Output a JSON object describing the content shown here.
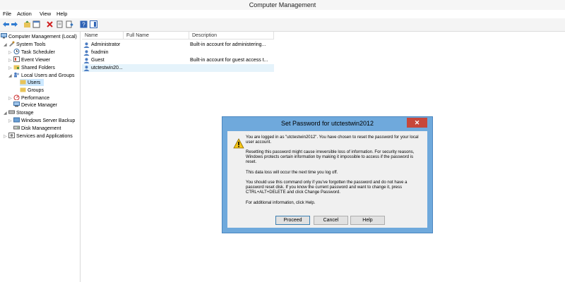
{
  "window": {
    "title": "Computer Management"
  },
  "menu": [
    "File",
    "Action",
    "View",
    "Help"
  ],
  "tree": {
    "root": "Computer Management (Local)",
    "system_tools": "System Tools",
    "task_scheduler": "Task Scheduler",
    "event_viewer": "Event Viewer",
    "shared_folders": "Shared Folders",
    "local_users_groups": "Local Users and Groups",
    "users": "Users",
    "groups": "Groups",
    "performance": "Performance",
    "device_manager": "Device Manager",
    "storage": "Storage",
    "windows_server_backup": "Windows Server Backup",
    "disk_management": "Disk Management",
    "services_applications": "Services and Applications"
  },
  "list": {
    "columns": [
      "Name",
      "Full Name",
      "Description"
    ],
    "rows": [
      {
        "name": "Administrator",
        "full_name": "",
        "description": "Built-in account for administering..."
      },
      {
        "name": "fxadmin",
        "full_name": "",
        "description": ""
      },
      {
        "name": "Guest",
        "full_name": "",
        "description": "Built-in account for guest access t..."
      },
      {
        "name": "utctestwin20...",
        "full_name": "",
        "description": ""
      }
    ]
  },
  "dialog": {
    "title": "Set Password for utctestwin2012",
    "close_label": "✕",
    "p1": "You are logged in as \"utctestwin2012\". You have chosen to reset the password for your local user account.",
    "p2": "Resetting this password might cause irreversible loss of information. For security reasons, Windows protects certain information by making it impossible to access if the password is reset.",
    "p3": "This data loss will occur the next time you log off.",
    "p4": "You should use this command only if you've forgotten the password and do not have a password reset disk. If you know the current password and want to change it, press CTRL+ALT+DELETE and click Change Password.",
    "p5": "For additional information, click Help.",
    "proceed": "Proceed",
    "cancel": "Cancel",
    "help": "Help"
  },
  "colors": {
    "dialog_frame": "#6fa9dc",
    "close_button": "#c7473a",
    "selection": "#cce8ff"
  }
}
